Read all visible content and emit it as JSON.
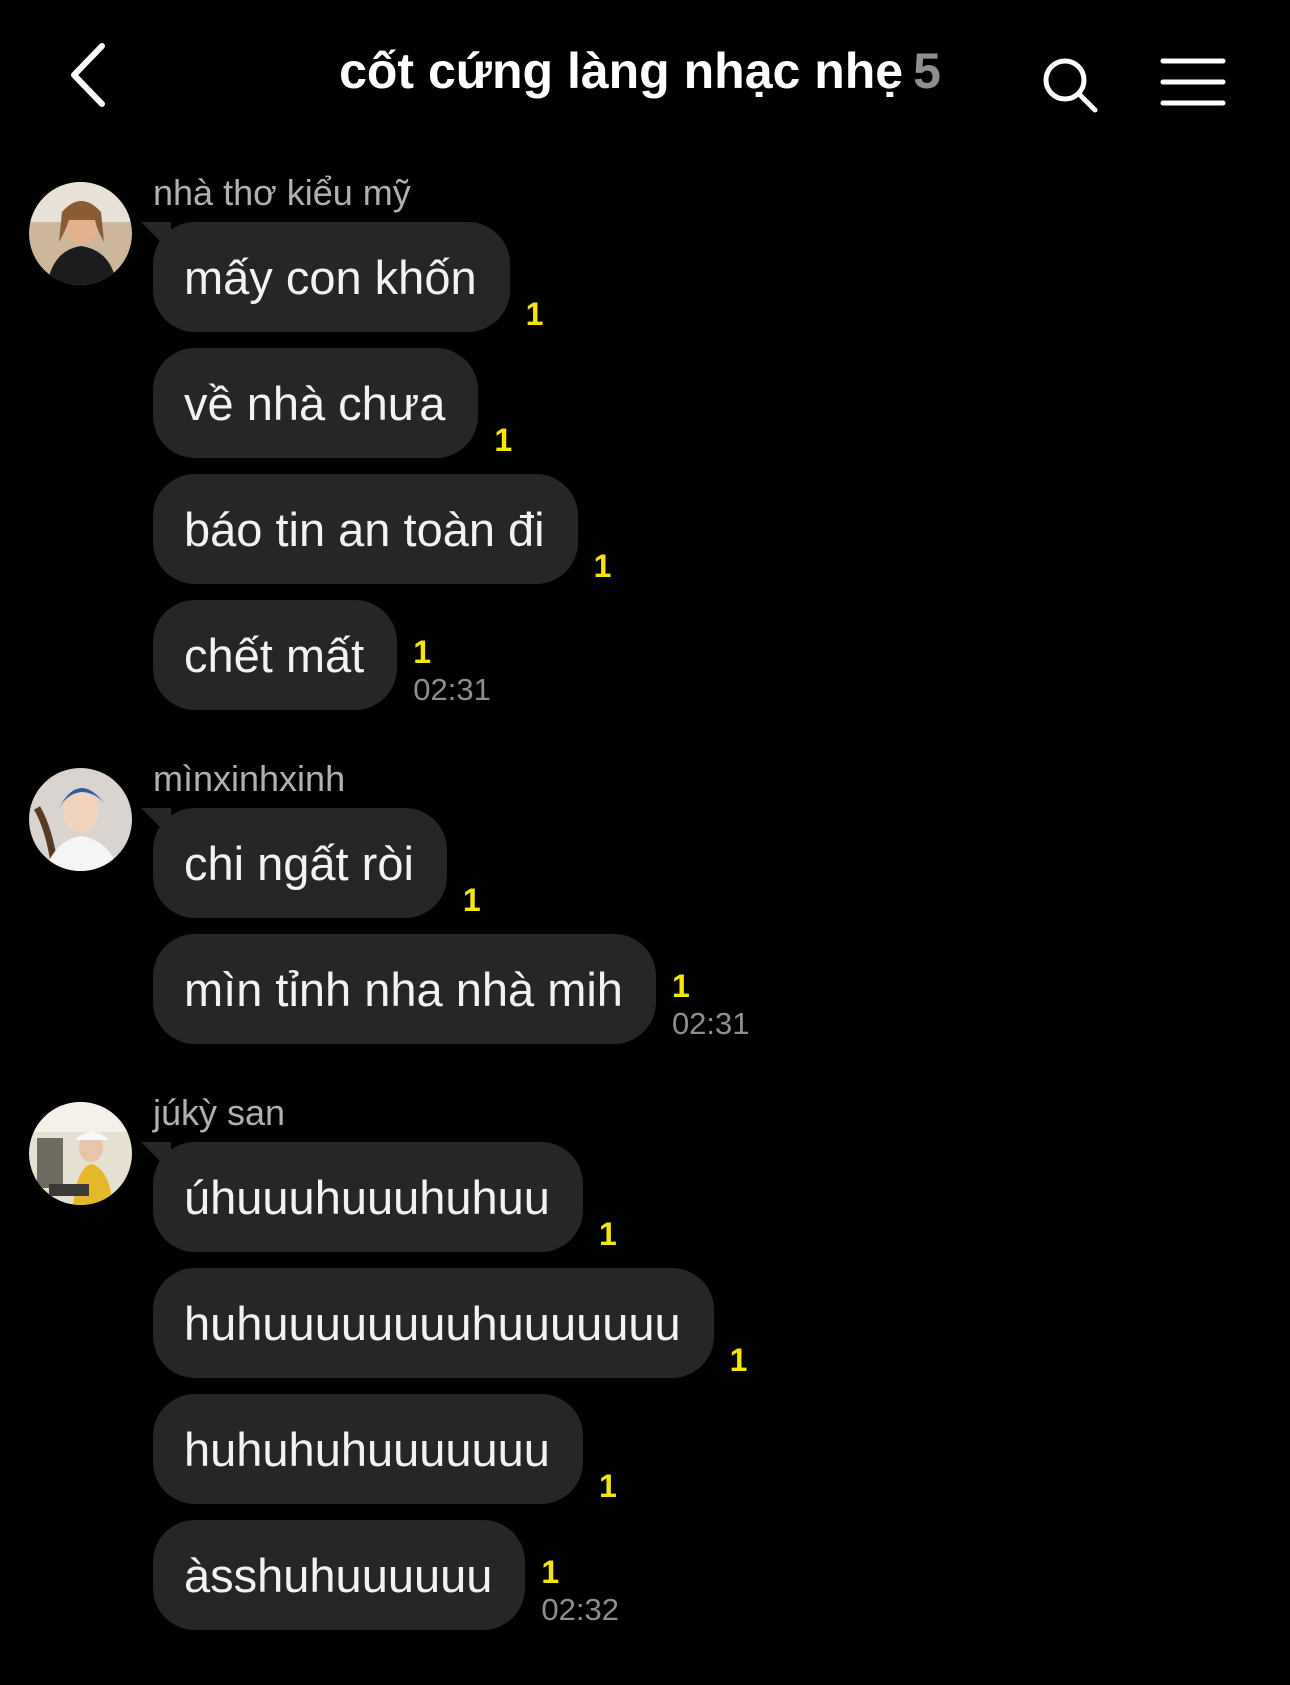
{
  "header": {
    "title": "cốt cứng làng nhạc nhẹ",
    "member_count": "5",
    "back_icon": "chevron-left-icon",
    "search_icon": "search-icon",
    "menu_icon": "hamburger-menu-icon"
  },
  "colors": {
    "background": "#000000",
    "bubble": "#262626",
    "unread": "#f5e50b",
    "muted": "#8e8e8e"
  },
  "groups": [
    {
      "sender": "nhà thơ kiểu mỹ",
      "messages": [
        {
          "text": "mấy con khốn",
          "unread": "1"
        },
        {
          "text": "về nhà chưa",
          "unread": "1"
        },
        {
          "text": "báo tin an toàn đi",
          "unread": "1"
        },
        {
          "text": "chết mất",
          "unread": "1",
          "time": "02:31"
        }
      ]
    },
    {
      "sender": "mìnxinhxinh",
      "messages": [
        {
          "text": "chi ngất ròi",
          "unread": "1"
        },
        {
          "text": "mìn tỉnh nha nhà mih",
          "unread": "1",
          "time": "02:31"
        }
      ]
    },
    {
      "sender": "júkỳ san",
      "messages": [
        {
          "text": "úhuuuhuuuhuhuu",
          "unread": "1"
        },
        {
          "text": "huhuuuuuuuuhuuuuuuu",
          "unread": "1"
        },
        {
          "text": "huhuhuhuuuuuuu",
          "unread": "1"
        },
        {
          "text": "àsshuhuuuuuu",
          "unread": "1",
          "time": "02:32"
        }
      ]
    }
  ]
}
